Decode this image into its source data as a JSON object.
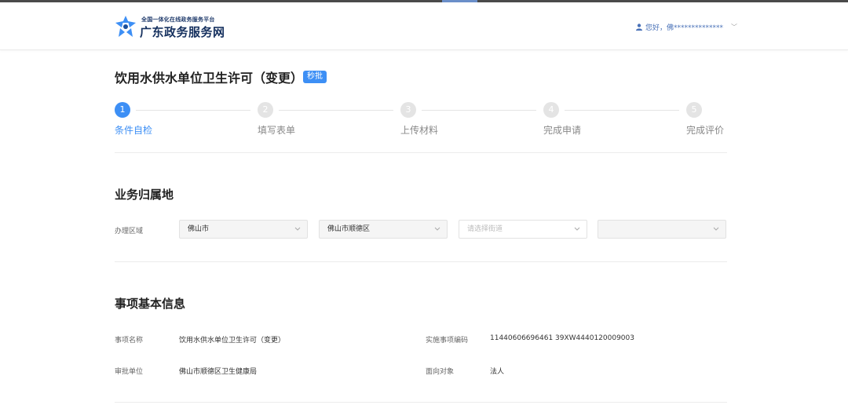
{
  "header": {
    "logo_subtitle": "全国一体化在线政务服务平台",
    "logo_title": "广东政务服务网",
    "user_greeting": "您好，佛**************"
  },
  "page": {
    "title": "饮用水供水单位卫生许可（变更）",
    "badge": "秒批"
  },
  "steps": [
    {
      "number": "1",
      "label": "条件自检",
      "active": true
    },
    {
      "number": "2",
      "label": "填写表单",
      "active": false
    },
    {
      "number": "3",
      "label": "上传材料",
      "active": false
    },
    {
      "number": "4",
      "label": "完成申请",
      "active": false
    },
    {
      "number": "5",
      "label": "完成评价",
      "active": false
    }
  ],
  "business_location": {
    "title": "业务归属地",
    "region_label": "办理区域",
    "city": "佛山市",
    "district": "佛山市顺德区",
    "street_placeholder": "请选择街道",
    "community": ""
  },
  "item_info": {
    "title": "事项基本信息",
    "name_label": "事项名称",
    "name_value": "饮用水供水单位卫生许可（变更）",
    "code_label": "实施事项编码",
    "code_value": "11440606696461 39XW4440120009003",
    "unit_label": "审批单位",
    "unit_value": "佛山市顺德区卫生健康局",
    "target_label": "面向对象",
    "target_value": "法人"
  },
  "colors": {
    "accent": "#3d8ff5",
    "inactive_step": "#e4e4e4",
    "brand_navy": "#15305e"
  }
}
